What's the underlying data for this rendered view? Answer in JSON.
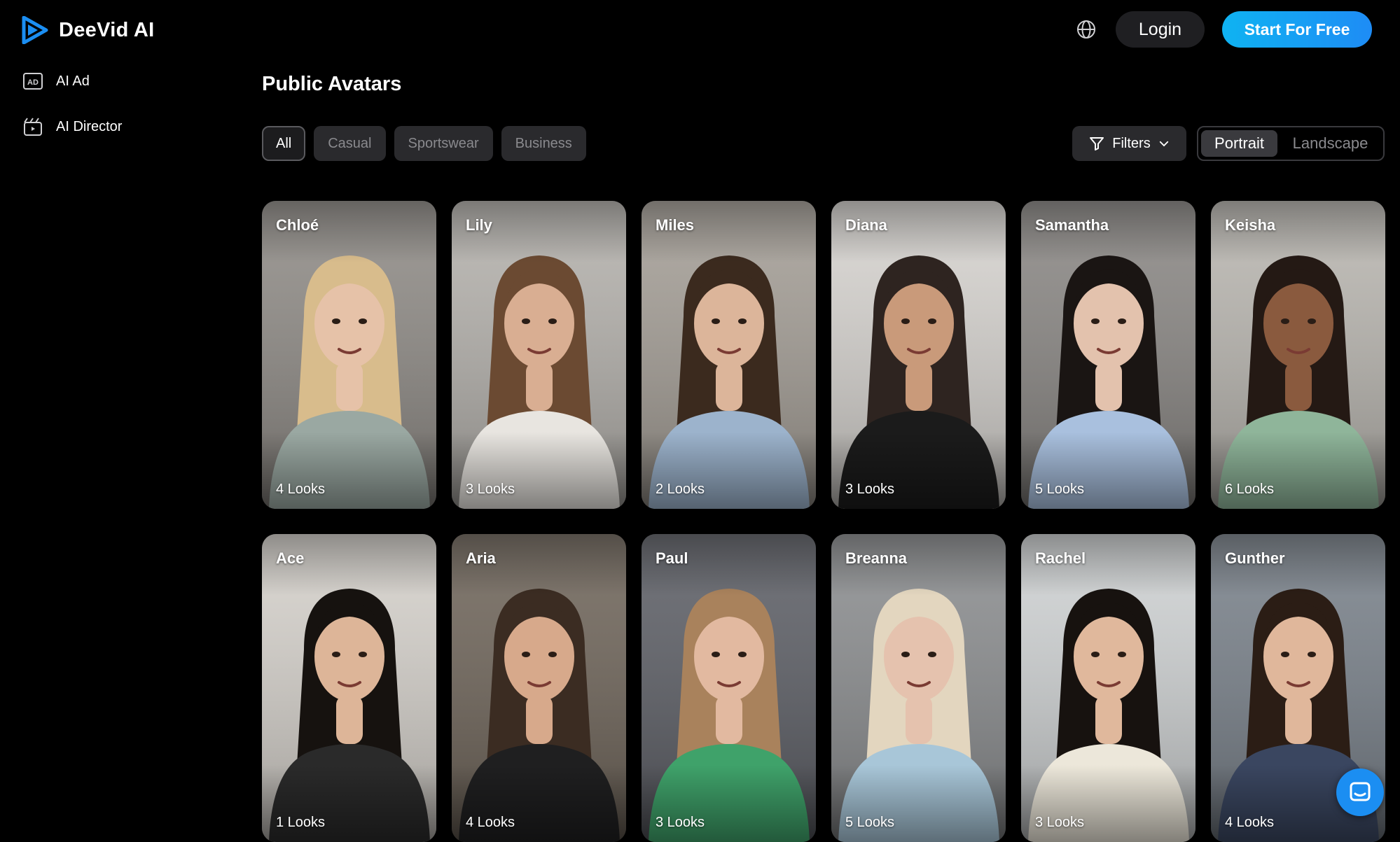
{
  "brand": {
    "name": "DeeVid AI",
    "accent": "#1b8ef2"
  },
  "header": {
    "login_label": "Login",
    "start_label": "Start For Free"
  },
  "sidebar": {
    "items": [
      {
        "label": "AI Ad",
        "icon": "ad-icon"
      },
      {
        "label": "AI Director",
        "icon": "clapperboard-icon"
      }
    ]
  },
  "main": {
    "title": "Public Avatars",
    "categories": [
      "All",
      "Casual",
      "Sportswear",
      "Business"
    ],
    "active_category": "All",
    "filters_label": "Filters",
    "orientation": {
      "options": [
        "Portrait",
        "Landscape"
      ],
      "selected": "Portrait"
    }
  },
  "avatars": [
    {
      "name": "Chloé",
      "looks": "4 Looks",
      "bg": "#8f8b86",
      "skin": "#e6c2a8",
      "hair": "#d8bc8c",
      "shirt": "#9aa8a2"
    },
    {
      "name": "Lily",
      "looks": "3 Looks",
      "bg": "#b4b1ac",
      "skin": "#d9ae92",
      "hair": "#6b4a32",
      "shirt": "#e8e5e0"
    },
    {
      "name": "Miles",
      "looks": "2 Looks",
      "bg": "#a49e96",
      "skin": "#dcb59a",
      "hair": "#3b2a1e",
      "shirt": "#9cb3cc"
    },
    {
      "name": "Diana",
      "looks": "3 Looks",
      "bg": "#d6d3cf",
      "skin": "#c99a7a",
      "hair": "#2e2420",
      "shirt": "#1b1b1b"
    },
    {
      "name": "Samantha",
      "looks": "5 Looks",
      "bg": "#8a8784",
      "skin": "#e3c2ad",
      "hair": "#1a1513",
      "shirt": "#a9c0de"
    },
    {
      "name": "Keisha",
      "looks": "6 Looks",
      "bg": "#b9b6b0",
      "skin": "#8a5a3e",
      "hair": "#241914",
      "shirt": "#8fb59a"
    },
    {
      "name": "Ace",
      "looks": "1 Looks",
      "bg": "#d5d1cb",
      "skin": "#ddb598",
      "hair": "#16120f",
      "shirt": "#2a2a2a"
    },
    {
      "name": "Aria",
      "looks": "4 Looks",
      "bg": "#6f655a",
      "skin": "#d7a98b",
      "hair": "#3b2c22",
      "shirt": "#1f1f20"
    },
    {
      "name": "Paul",
      "looks": "3 Looks",
      "bg": "#5d5f66",
      "skin": "#e2b9a0",
      "hair": "#a9825c",
      "shirt": "#3fa26a"
    },
    {
      "name": "Breanna",
      "looks": "5 Looks",
      "bg": "#8b8d8f",
      "skin": "#e5c2ae",
      "hair": "#e3d6bf",
      "shirt": "#a8c6d8"
    },
    {
      "name": "Rachel",
      "looks": "3 Looks",
      "bg": "#cfd2d3",
      "skin": "#e0b89c",
      "hair": "#17120f",
      "shirt": "#ece7da"
    },
    {
      "name": "Gunther",
      "looks": "4 Looks",
      "bg": "#79818a",
      "skin": "#e0b79b",
      "hair": "#2b1d15",
      "shirt": "#3a4660"
    }
  ]
}
